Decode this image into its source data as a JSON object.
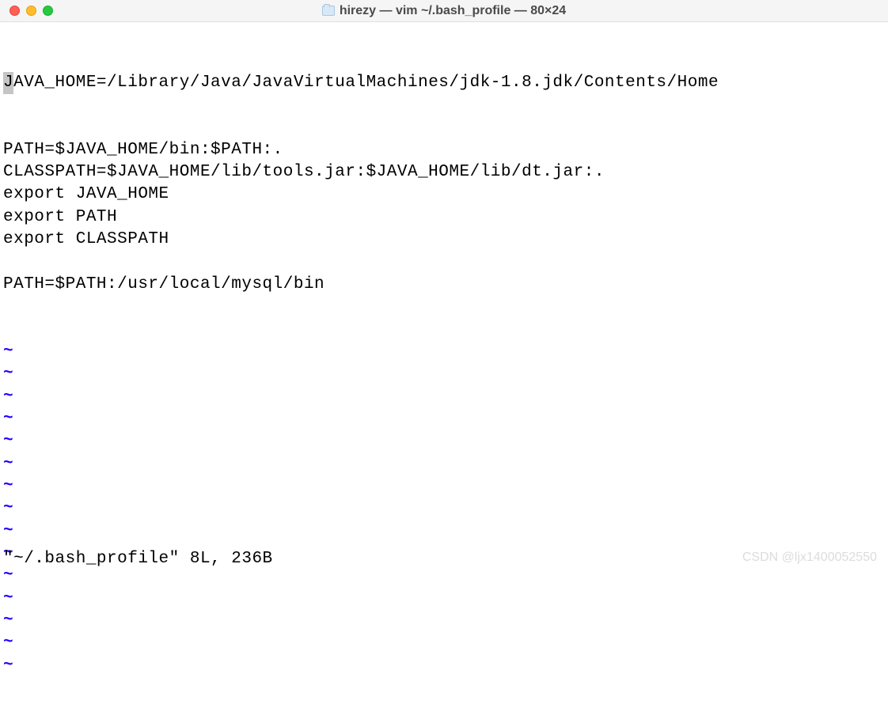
{
  "window": {
    "title": "hirezy — vim ~/.bash_profile — 80×24"
  },
  "editor": {
    "cursor_char": "J",
    "first_line_rest": "AVA_HOME=/Library/Java/JavaVirtualMachines/jdk-1.8.jdk/Contents/Home",
    "lines": [
      "PATH=$JAVA_HOME/bin:$PATH:.",
      "CLASSPATH=$JAVA_HOME/lib/tools.jar:$JAVA_HOME/lib/dt.jar:.",
      "export JAVA_HOME",
      "export PATH",
      "export CLASSPATH",
      "",
      "PATH=$PATH:/usr/local/mysql/bin"
    ],
    "tilde": "~",
    "tilde_count": 15,
    "status": "\"~/.bash_profile\" 8L, 236B"
  },
  "watermark": "CSDN @ljx1400052550"
}
